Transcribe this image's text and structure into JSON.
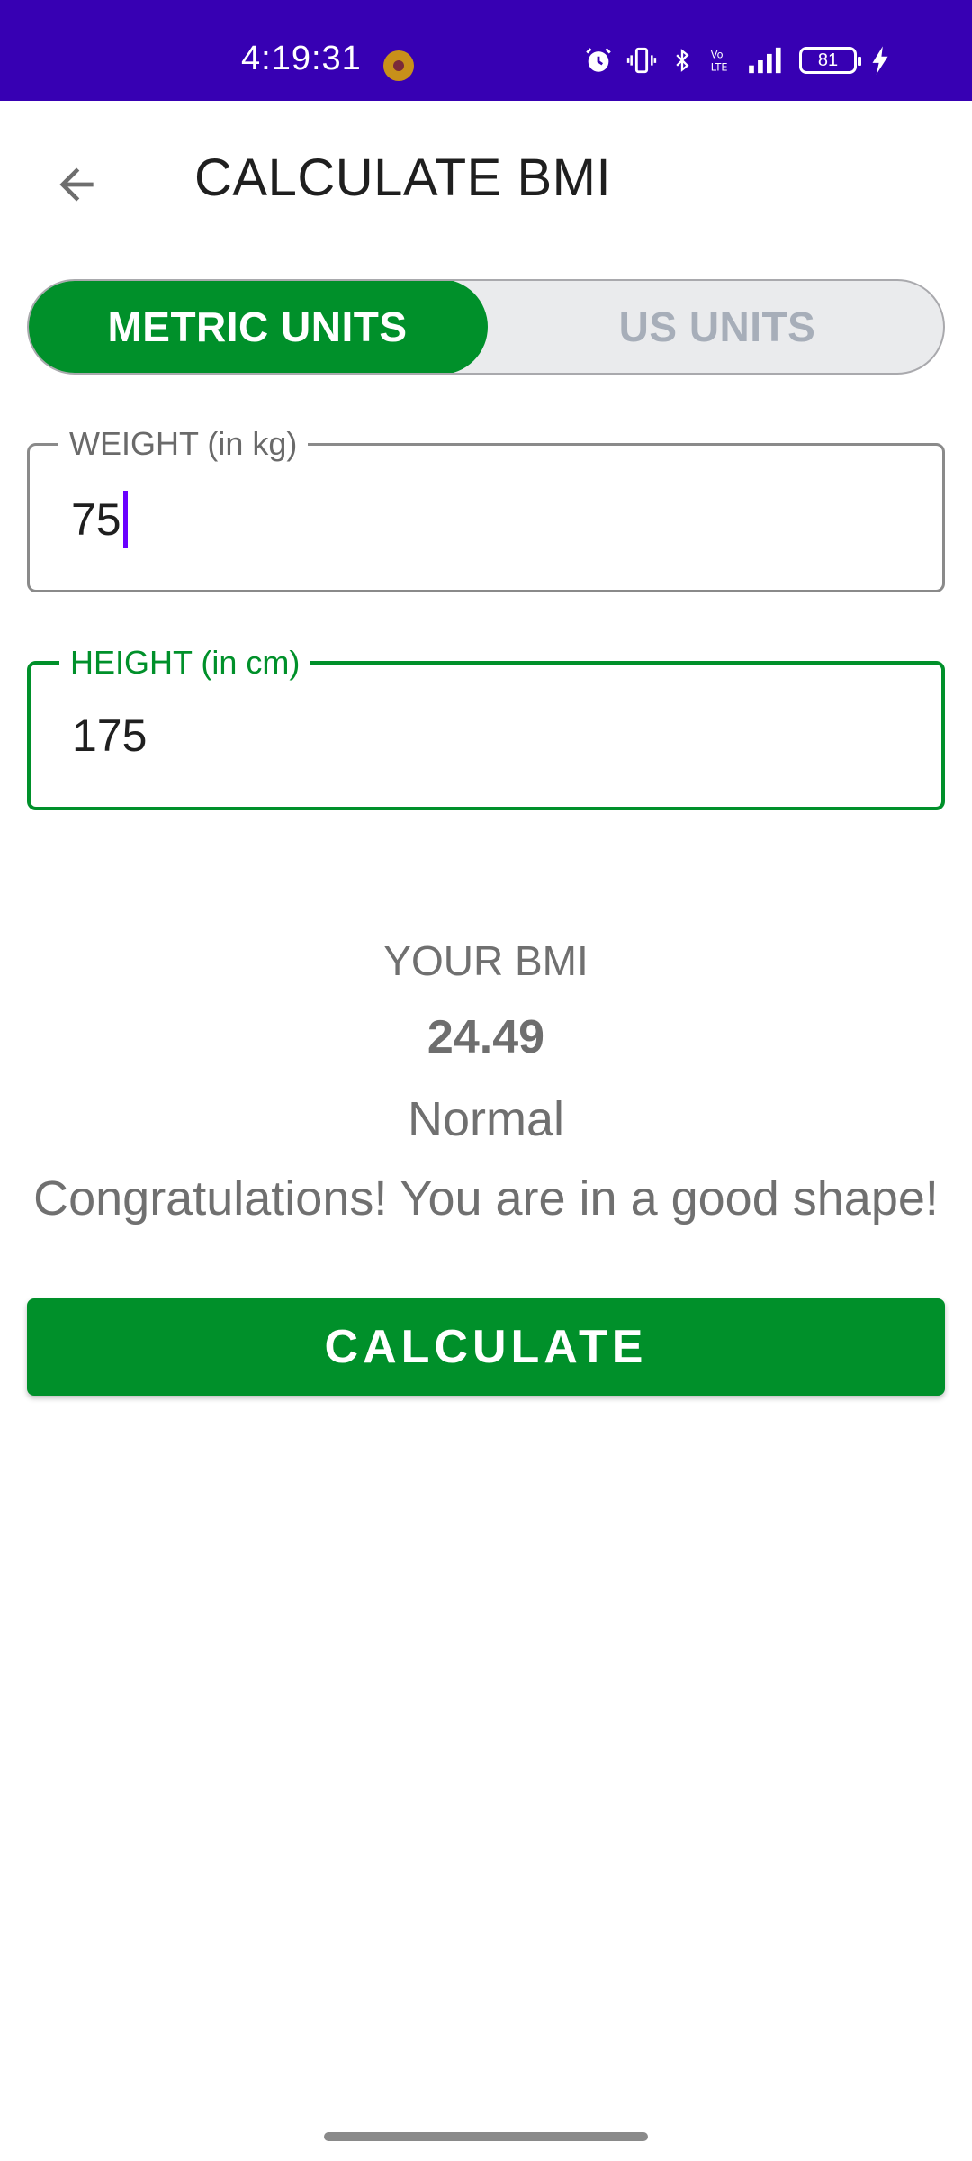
{
  "status_bar": {
    "time": "4:19:31",
    "battery": "81"
  },
  "app_bar": {
    "title": "CALCULATE BMI"
  },
  "unit_toggle": {
    "options": [
      "METRIC UNITS",
      "US UNITS"
    ],
    "selected": "METRIC UNITS"
  },
  "weight_field": {
    "label": "WEIGHT (in kg)",
    "value": "75"
  },
  "height_field": {
    "label": "HEIGHT (in cm)",
    "value": "175"
  },
  "result": {
    "title": "YOUR BMI",
    "value": "24.49",
    "type": "Normal",
    "description": "Congratulations! You are in a good shape!"
  },
  "calculate_button": {
    "label": "CALCULATE"
  },
  "colors": {
    "status_bar": "#3700b3",
    "accent_green": "#00902a",
    "caret": "#6a00ff"
  }
}
